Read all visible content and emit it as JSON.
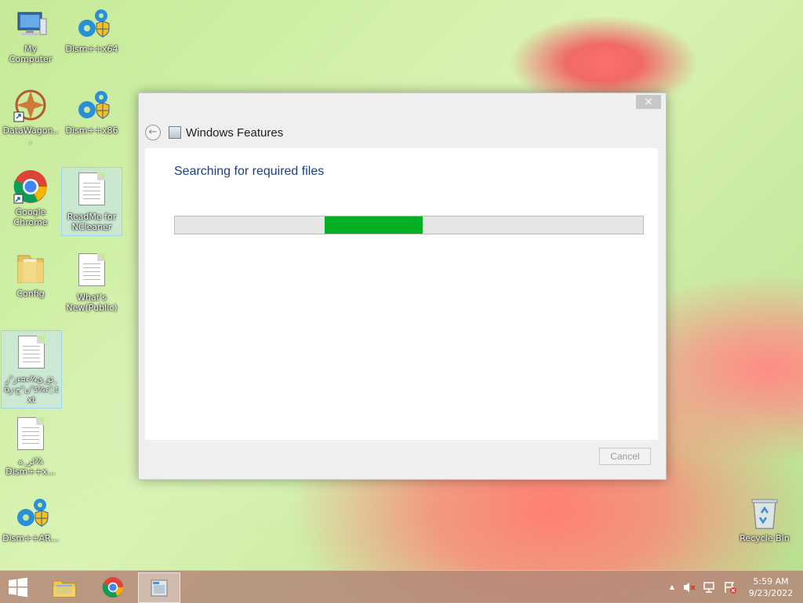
{
  "desktop": {
    "icons": [
      {
        "label": "My Computer"
      },
      {
        "label": "Dism++x64"
      },
      {
        "label": "DataWagon..."
      },
      {
        "label": "Dism++x86"
      },
      {
        "label": "Google Chrome"
      },
      {
        "label": "ReadMe for NCleaner"
      },
      {
        "label": "Config"
      },
      {
        "label": "What's New(Public)"
      },
      {
        "label": "ئۈ¸ئ¾ء¤ءز°ر¸ôء¼ڈ°ن°ح·ز°ِ.txt"
      },
      {
        "label": "ئر¸ہ¾ Dism++x..."
      },
      {
        "label": "Dism++AR..."
      },
      {
        "label": "Recycle Bin"
      }
    ]
  },
  "dialog": {
    "title": "Windows Features",
    "message": "Searching for required files",
    "progress": {
      "start": 0.32,
      "end": 0.53
    },
    "cancel_label": "Cancel",
    "close_glyph": "×",
    "back_glyph": "←"
  },
  "taskbar": {
    "clock_time": "5:59 AM",
    "clock_date": "9/23/2022",
    "tray_up_glyph": "▲"
  },
  "colors": {
    "progress_fill": "#06b025",
    "title_text": "#1c3f83"
  }
}
